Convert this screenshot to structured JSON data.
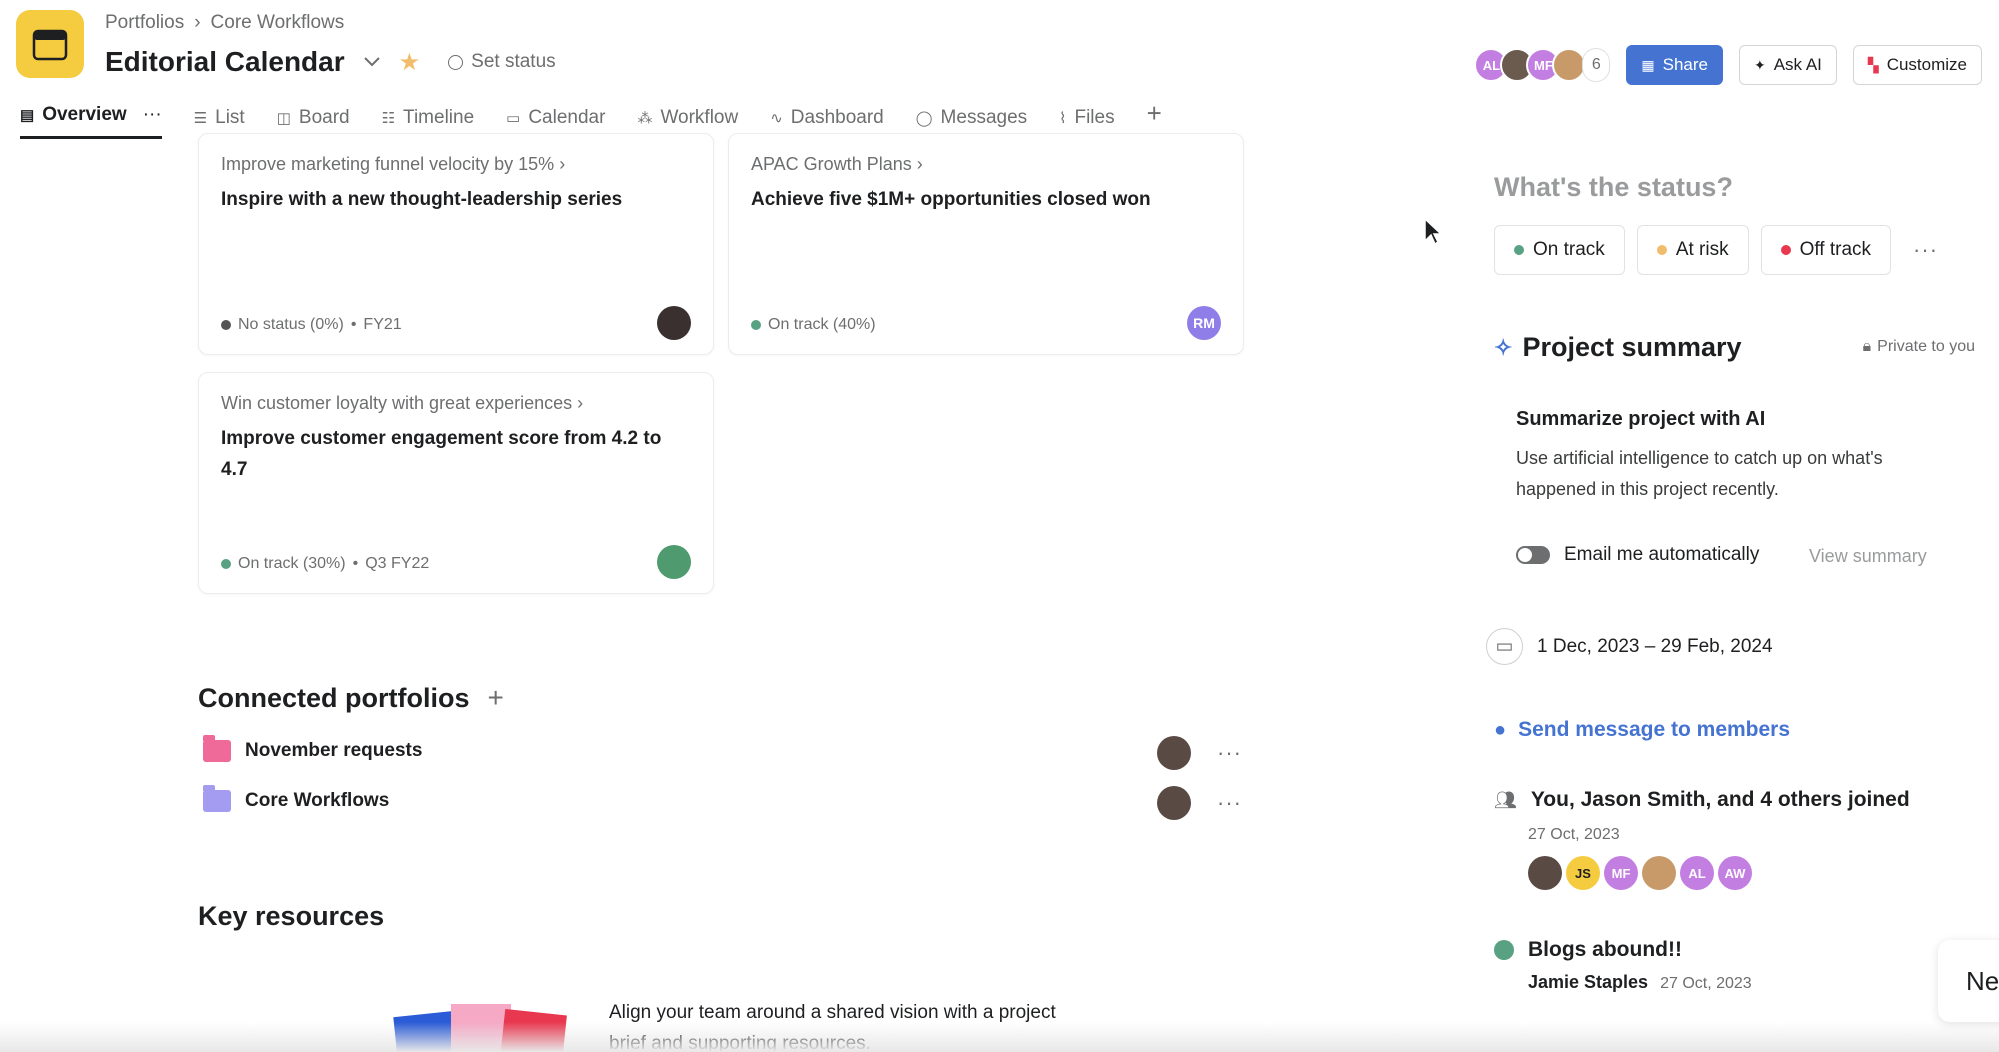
{
  "header": {
    "breadcrumb": [
      "Portfolios",
      "Core Workflows"
    ],
    "breadcrumb_sep": "›",
    "title": "Editorial Calendar",
    "set_status": "Set status",
    "member_avatars": [
      {
        "initials": "AL",
        "color": "#c27ee0"
      },
      {
        "initials": "",
        "color": "#6b5a4e"
      },
      {
        "initials": "MF",
        "color": "#c27ee0"
      },
      {
        "initials": "",
        "color": "#c89a6a"
      }
    ],
    "member_count": "6",
    "share_label": "Share",
    "ask_ai_label": "Ask AI",
    "customize_label": "Customize"
  },
  "tabs": [
    {
      "label": "Overview",
      "icon": "clipboard-icon",
      "active": true
    },
    {
      "label": "List",
      "icon": "list-icon"
    },
    {
      "label": "Board",
      "icon": "board-icon"
    },
    {
      "label": "Timeline",
      "icon": "timeline-icon"
    },
    {
      "label": "Calendar",
      "icon": "calendar-icon"
    },
    {
      "label": "Workflow",
      "icon": "workflow-icon"
    },
    {
      "label": "Dashboard",
      "icon": "dashboard-icon"
    },
    {
      "label": "Messages",
      "icon": "message-icon"
    },
    {
      "label": "Files",
      "icon": "paperclip-icon"
    }
  ],
  "goals": [
    {
      "parent": "Improve marketing funnel velocity by 15%",
      "title": "Inspire with a new thought-leadership series",
      "status": "No status (0%)",
      "period": "FY21",
      "status_color": "#555555",
      "owner_initials": "",
      "owner_color": "#3a3030"
    },
    {
      "parent": "APAC Growth Plans",
      "title": "Achieve five $1M+ opportunities closed won",
      "status": "On track (40%)",
      "period": "",
      "status_color": "#58a182",
      "owner_initials": "RM",
      "owner_color": "#8f7ee7"
    },
    {
      "parent": "Win customer loyalty with great experiences",
      "title": "Improve customer engagement score from 4.2 to 4.7",
      "status": "On track (30%)",
      "period": "Q3 FY22",
      "status_color": "#58a182",
      "owner_initials": "",
      "owner_color": "#4f9a6f"
    }
  ],
  "connected_portfolios": {
    "title": "Connected portfolios",
    "items": [
      {
        "name": "November requests",
        "color": "#f06a99"
      },
      {
        "name": "Core Workflows",
        "color": "#a49cf0"
      }
    ]
  },
  "key_resources": {
    "title": "Key resources",
    "text": "Align your team around a shared vision with a project brief and supporting resources."
  },
  "right_panel": {
    "status_question": "What's the status?",
    "status_options": [
      {
        "label": "On track",
        "color": "#58a182"
      },
      {
        "label": "At risk",
        "color": "#f1bd6c"
      },
      {
        "label": "Off track",
        "color": "#e8384f"
      }
    ],
    "summary_title": "Project summary",
    "private_label": "Private to you",
    "ai_title": "Summarize project with AI",
    "ai_desc": "Use artificial intelligence to catch up on what's happened in this project recently.",
    "email_toggle_label": "Email me automatically",
    "view_summary": "View summary",
    "date_range": "1 Dec, 2023 – 29 Feb, 2024",
    "send_message": "Send message to members",
    "joined_text": "You, Jason Smith, and 4 others joined",
    "joined_date": "27 Oct, 2023",
    "joined_avatars": [
      {
        "initials": "",
        "color": "#5a4a44"
      },
      {
        "initials": "JS",
        "color": "#f5cb3f"
      },
      {
        "initials": "MF",
        "color": "#c27ee0"
      },
      {
        "initials": "",
        "color": "#c89a6a"
      },
      {
        "initials": "AL",
        "color": "#c27ee0"
      },
      {
        "initials": "AW",
        "color": "#c27ee0"
      }
    ],
    "blog_title": "Blogs abound!!",
    "blog_author": "Jamie Staples",
    "blog_date": "27 Oct, 2023",
    "floating_pill": "Ne"
  }
}
